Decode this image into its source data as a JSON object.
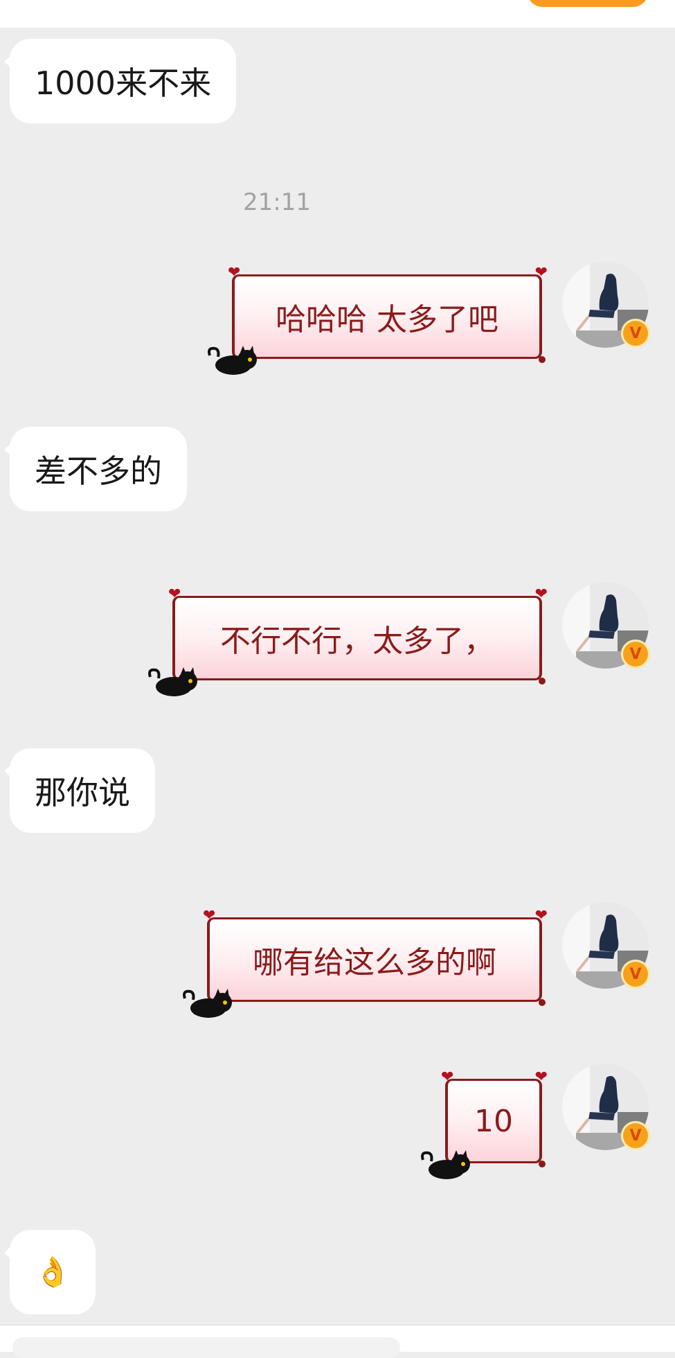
{
  "timestamp": "21:11",
  "messages": [
    {
      "text": "1000来不来"
    },
    {
      "text": "哈哈哈 太多了吧"
    },
    {
      "text": "差不多的"
    },
    {
      "text": "不行不行，太多了，"
    },
    {
      "text": "那你说"
    },
    {
      "text": "哪有给这么多的啊"
    },
    {
      "text": "10"
    },
    {
      "text": "👌"
    }
  ],
  "icons": {
    "verified_badge": "v-badge-icon",
    "bubble_decoration": "cat-icon",
    "heart": "heart-icon"
  },
  "colors": {
    "background": "#ededed",
    "incoming_bubble": "#ffffff",
    "outgoing_border": "#8b1a1a",
    "outgoing_text": "#8b1a1a",
    "badge": "#f5a21a"
  }
}
